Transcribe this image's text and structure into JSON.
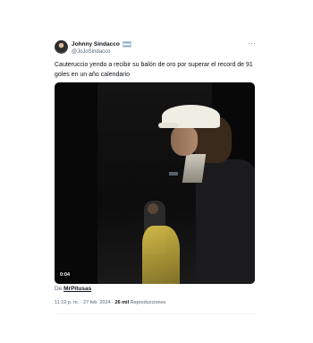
{
  "author": {
    "display_name": "Johnny Sindacco",
    "handle": "@JoJoSindacco",
    "flag_icon": "argentina-flag-icon"
  },
  "more_icon": "···",
  "tweet": {
    "text": "Cauteruccio yendo a recibir su balón de oro por superar el record de 91 goles en un año calendario"
  },
  "video": {
    "duration": "0:04"
  },
  "source": {
    "prefix": "De",
    "account": "MrPitusas"
  },
  "meta": {
    "time": "11:19 p. m.",
    "separator": "·",
    "date": "27 feb. 2024",
    "views_count": "26 mil",
    "views_label": "Reproducciones"
  },
  "colors": {
    "text_primary": "#0f1419",
    "text_secondary": "#536471",
    "video_bg": "#080808"
  }
}
